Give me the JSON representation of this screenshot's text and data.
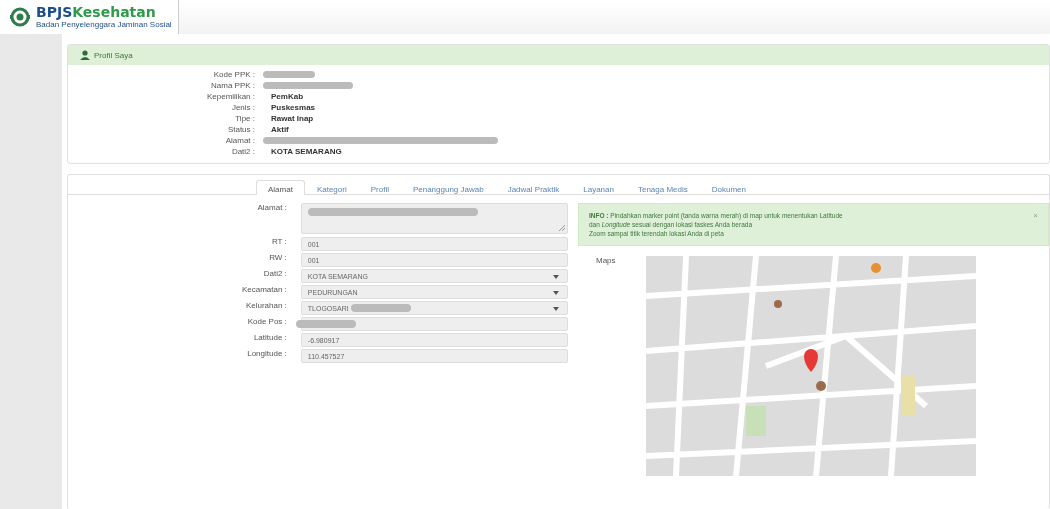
{
  "header": {
    "logo_title": "BPJS",
    "logo_title_accent": "Kesehatan",
    "logo_subtitle": "Badan Penyelenggara Jaminan Sosial"
  },
  "profile": {
    "title": "Profil Saya",
    "fields": [
      {
        "label": "Kode PPK :",
        "kind": "redacted"
      },
      {
        "label": "Nama PPK :",
        "kind": "redacted"
      },
      {
        "label": "Kepemilikan :",
        "kind": "text",
        "value": "PemKab"
      },
      {
        "label": "Jenis :",
        "kind": "text",
        "value": "Puskesmas"
      },
      {
        "label": "Tipe :",
        "kind": "text",
        "value": "Rawat Inap"
      },
      {
        "label": "Status :",
        "kind": "text",
        "value": "Aktif"
      },
      {
        "label": "Alamat :",
        "kind": "redacted"
      },
      {
        "label": "Dati2 :",
        "kind": "text",
        "value": "KOTA SEMARANG"
      }
    ]
  },
  "tabs": [
    {
      "label": "Alamat",
      "selected": true
    },
    {
      "label": "Kategori",
      "selected": false
    },
    {
      "label": "Profil",
      "selected": false
    },
    {
      "label": "Penanggung Jawab",
      "selected": false
    },
    {
      "label": "Jadwal Praktik",
      "selected": false
    },
    {
      "label": "Layanan",
      "selected": false
    },
    {
      "label": "Tenaga Medis",
      "selected": false
    },
    {
      "label": "Dokumen",
      "selected": false
    }
  ],
  "form": [
    {
      "label": "Alamat :",
      "kind": "textarea",
      "redacted": true
    },
    {
      "label": "RT :",
      "kind": "input",
      "value": "001"
    },
    {
      "label": "RW :",
      "kind": "input",
      "value": "001"
    },
    {
      "label": "Dati2 :",
      "kind": "select",
      "value": "KOTA SEMARANG"
    },
    {
      "label": "Kecamatan :",
      "kind": "select",
      "value": "PEDURUNGAN"
    },
    {
      "label": "Kelurahan :",
      "kind": "select",
      "value": "TLOGOSARI",
      "redacted": true
    },
    {
      "label": "Kode Pos :",
      "kind": "input",
      "redacted": true
    },
    {
      "label": "Latitude :",
      "kind": "input",
      "value": "-6.980917"
    },
    {
      "label": "Longitude :",
      "kind": "input",
      "value": "110.457527"
    }
  ],
  "info": {
    "lines": [
      "**INFO :** Pindahkan marker point (tanda warna merah) di map untuk menentukan Latitude",
      "dan *Longitude* sesuai dengan lokasi faskes Anda berada",
      "Zoom sampai titik terendah lokasi Anda di peta"
    ],
    "close": "×"
  },
  "map": {
    "label": "Maps",
    "kind": "picture"
  }
}
